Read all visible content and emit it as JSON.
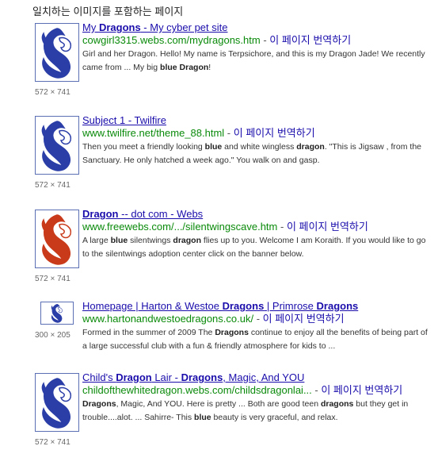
{
  "heading": "일치하는 이미지를 포함하는 페이지",
  "results": [
    {
      "title_parts": [
        {
          "t": "My ",
          "b": false
        },
        {
          "t": "Dragons",
          "b": true
        },
        {
          "t": " - My cyber pet site",
          "b": false
        }
      ],
      "url": "cowgirl3315.webs.com/mydragons.htm",
      "separator": " - ",
      "translate": "이 페이지 번역하기",
      "snippet_parts": [
        {
          "t": "Girl and her Dragon. Hello! My name is Terpsichore, and this is my Dragon Jade! We recently came from ... My big ",
          "b": false
        },
        {
          "t": "blue Dragon",
          "b": true
        },
        {
          "t": "!",
          "b": false
        }
      ],
      "dims": "572 × 741",
      "thumb_color": "#2b3ea8"
    },
    {
      "title_parts": [
        {
          "t": "Subject 1 - Twilfire",
          "b": false
        }
      ],
      "url": "www.twilfire.net/theme_88.html",
      "separator": " - ",
      "translate": "이 페이지 번역하기",
      "snippet_parts": [
        {
          "t": "Then you meet a friendly looking ",
          "b": false
        },
        {
          "t": "blue",
          "b": true
        },
        {
          "t": " and white wingless ",
          "b": false
        },
        {
          "t": "dragon",
          "b": true
        },
        {
          "t": ". \"This is Jigsaw , from the Sanctuary. He only hatched a week ago.\" You walk on and gasp.",
          "b": false
        }
      ],
      "dims": "572 × 741",
      "thumb_color": "#2b3ea8"
    },
    {
      "title_parts": [
        {
          "t": "Dragon",
          "b": true
        },
        {
          "t": " -- dot com - Webs",
          "b": false
        }
      ],
      "url": "www.freewebs.com/.../silentwingscave.htm",
      "separator": " - ",
      "translate": "이 페이지 번역하기",
      "snippet_parts": [
        {
          "t": "A large ",
          "b": false
        },
        {
          "t": "blue",
          "b": true
        },
        {
          "t": " silentwings ",
          "b": false
        },
        {
          "t": "dragon",
          "b": true
        },
        {
          "t": " flies up to you. Welcome I am Koraith. If you would like to go to the silentwings adoption center click on the banner below.",
          "b": false
        }
      ],
      "dims": "572 × 741",
      "thumb_color": "#c83a1a"
    },
    {
      "title_parts": [
        {
          "t": "Homepage | Harton & Westoe ",
          "b": false
        },
        {
          "t": "Dragons",
          "b": true
        },
        {
          "t": " | Primrose ",
          "b": false
        },
        {
          "t": "Dragons",
          "b": true
        }
      ],
      "url": "www.hartonandwestoedragons.co.uk/",
      "separator": " - ",
      "translate": "이 페이지 번역하기",
      "snippet_parts": [
        {
          "t": "Formed in the summer of 2009 The ",
          "b": false
        },
        {
          "t": "Dragons",
          "b": true
        },
        {
          "t": " continue to enjoy all the benefits of being part of a large successful club with a fun & friendly atmosphere for kids to ...",
          "b": false
        }
      ],
      "dims": "300 × 205",
      "thumb_color": "#2b3ea8"
    },
    {
      "title_parts": [
        {
          "t": "Child's ",
          "b": false
        },
        {
          "t": "Dragon",
          "b": true
        },
        {
          "t": " Lair - ",
          "b": false
        },
        {
          "t": "Dragons",
          "b": true
        },
        {
          "t": ", Magic, And YOU",
          "b": false
        }
      ],
      "url": "childofthewhitedragon.webs.com/childsdragonlai...",
      "separator": " - ",
      "translate": "이 페이지 번역하기",
      "snippet_parts": [
        {
          "t": "Dragons",
          "b": true
        },
        {
          "t": ", Magic, And YOU. Here is pretty ... Both are good teen ",
          "b": false
        },
        {
          "t": "dragons",
          "b": true
        },
        {
          "t": " but they get in trouble....alot. ... Sahirre- This ",
          "b": false
        },
        {
          "t": "blue",
          "b": true
        },
        {
          "t": " beauty is very graceful, and relax.",
          "b": false
        }
      ],
      "dims": "572 × 741",
      "thumb_color": "#2b3ea8"
    }
  ]
}
